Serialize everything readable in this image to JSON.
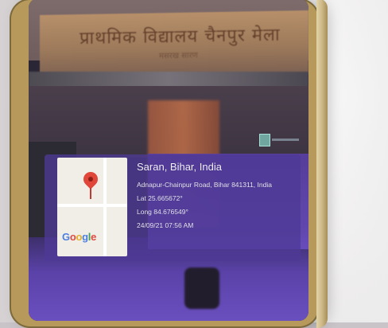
{
  "photo": {
    "signboard_text": "प्राथमिक विद्यालय चैनपुर मेला",
    "signboard_subtext": "मसरख सारण"
  },
  "geotag": {
    "place_title": "Saran, Bihar, India",
    "address": "Adnapur-Chainpur Road, Bihar 841311, India",
    "lat": "Lat 25.665672°",
    "long": "Long 84.676549°",
    "datetime": "24/09/21 07:56 AM",
    "map_logo": "Google"
  },
  "colors": {
    "overlay": "#4e3a96",
    "pin": "#e0463a"
  }
}
